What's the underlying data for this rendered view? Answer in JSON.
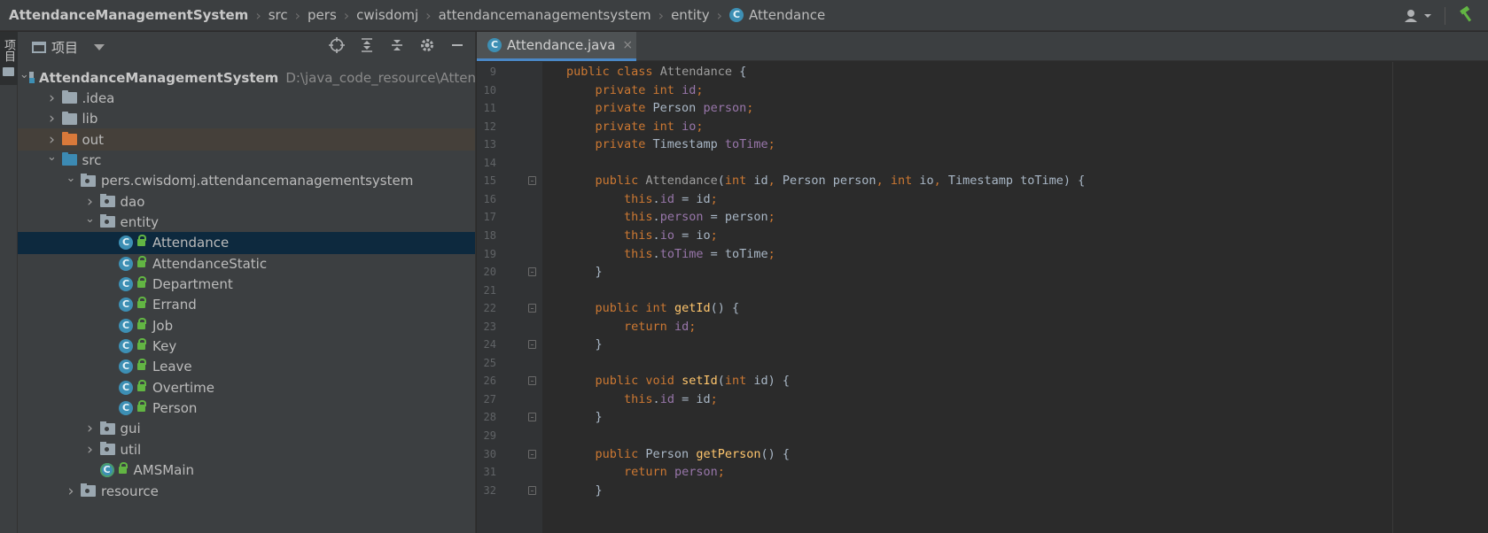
{
  "navbar": {
    "breadcrumbs": [
      "AttendanceManagementSystem",
      "src",
      "pers",
      "cwisdomj",
      "attendancemanagementsystem",
      "entity",
      "Attendance"
    ],
    "class_icon_letter": "C"
  },
  "stripe": {
    "label": "项目"
  },
  "project_panel": {
    "title": "项目",
    "tree": [
      {
        "label": "AttendanceManagementSystem",
        "path": "D:\\java_code_resource\\Atten",
        "indent": 0,
        "expanded": true,
        "icon": "module-icon",
        "bold": true
      },
      {
        "label": ".idea",
        "indent": 1,
        "expanded": false,
        "icon": "folder-grey"
      },
      {
        "label": "lib",
        "indent": 1,
        "expanded": false,
        "icon": "folder-grey"
      },
      {
        "label": "out",
        "indent": 1,
        "expanded": false,
        "icon": "folder-orange",
        "highlight": "out"
      },
      {
        "label": "src",
        "indent": 1,
        "expanded": true,
        "icon": "folder-blue"
      },
      {
        "label": "pers.cwisdomj.attendancemanagementsystem",
        "indent": 2,
        "expanded": true,
        "icon": "package"
      },
      {
        "label": "dao",
        "indent": 3,
        "expanded": false,
        "icon": "package"
      },
      {
        "label": "entity",
        "indent": 3,
        "expanded": true,
        "icon": "package"
      },
      {
        "label": "Attendance",
        "indent": 4,
        "icon": "class",
        "selected": true
      },
      {
        "label": "AttendanceStatic",
        "indent": 4,
        "icon": "class"
      },
      {
        "label": "Department",
        "indent": 4,
        "icon": "class"
      },
      {
        "label": "Errand",
        "indent": 4,
        "icon": "class"
      },
      {
        "label": "Job",
        "indent": 4,
        "icon": "class"
      },
      {
        "label": "Key",
        "indent": 4,
        "icon": "class"
      },
      {
        "label": "Leave",
        "indent": 4,
        "icon": "class"
      },
      {
        "label": "Overtime",
        "indent": 4,
        "icon": "class"
      },
      {
        "label": "Person",
        "indent": 4,
        "icon": "class"
      },
      {
        "label": "gui",
        "indent": 3,
        "expanded": false,
        "icon": "package"
      },
      {
        "label": "util",
        "indent": 3,
        "expanded": false,
        "icon": "package"
      },
      {
        "label": "AMSMain",
        "indent": 3,
        "icon": "class-run"
      },
      {
        "label": "resource",
        "indent": 2,
        "expanded": false,
        "icon": "package"
      }
    ]
  },
  "editor": {
    "tab_label": "Attendance.java",
    "lines": [
      {
        "n": "9",
        "tokens": [
          [
            "kw",
            "public "
          ],
          [
            "kw",
            "class "
          ],
          [
            "gray-cls",
            "Attendance "
          ],
          [
            "cn",
            "{"
          ]
        ]
      },
      {
        "n": "10",
        "tokens": [
          [
            "cn",
            "    "
          ],
          [
            "kw",
            "private "
          ],
          [
            "kw",
            "int "
          ],
          [
            "fld",
            "id"
          ],
          [
            "pun",
            ";"
          ]
        ]
      },
      {
        "n": "11",
        "tokens": [
          [
            "cn",
            "    "
          ],
          [
            "kw",
            "private "
          ],
          [
            "cn",
            "Person "
          ],
          [
            "fld",
            "person"
          ],
          [
            "pun",
            ";"
          ]
        ]
      },
      {
        "n": "12",
        "tokens": [
          [
            "cn",
            "    "
          ],
          [
            "kw",
            "private "
          ],
          [
            "kw",
            "int "
          ],
          [
            "fld",
            "io"
          ],
          [
            "pun",
            ";"
          ]
        ]
      },
      {
        "n": "13",
        "tokens": [
          [
            "cn",
            "    "
          ],
          [
            "kw",
            "private "
          ],
          [
            "cn",
            "Timestamp "
          ],
          [
            "fld",
            "toTime"
          ],
          [
            "pun",
            ";"
          ]
        ]
      },
      {
        "n": "14",
        "tokens": []
      },
      {
        "n": "15",
        "fold": true,
        "tokens": [
          [
            "cn",
            "    "
          ],
          [
            "kw",
            "public "
          ],
          [
            "gray-cls",
            "Attendance"
          ],
          [
            "cn",
            "("
          ],
          [
            "kw",
            "int "
          ],
          [
            "cn",
            "id"
          ],
          [
            "pun",
            ", "
          ],
          [
            "cn",
            "Person person"
          ],
          [
            "pun",
            ", "
          ],
          [
            "kw",
            "int "
          ],
          [
            "cn",
            "io"
          ],
          [
            "pun",
            ", "
          ],
          [
            "cn",
            "Timestamp toTime) {"
          ]
        ]
      },
      {
        "n": "16",
        "tokens": [
          [
            "cn",
            "        "
          ],
          [
            "kw",
            "this"
          ],
          [
            "cn",
            "."
          ],
          [
            "fld",
            "id"
          ],
          [
            "cn",
            " = id"
          ],
          [
            "pun",
            ";"
          ]
        ]
      },
      {
        "n": "17",
        "tokens": [
          [
            "cn",
            "        "
          ],
          [
            "kw",
            "this"
          ],
          [
            "cn",
            "."
          ],
          [
            "fld",
            "person"
          ],
          [
            "cn",
            " = person"
          ],
          [
            "pun",
            ";"
          ]
        ]
      },
      {
        "n": "18",
        "tokens": [
          [
            "cn",
            "        "
          ],
          [
            "kw",
            "this"
          ],
          [
            "cn",
            "."
          ],
          [
            "fld",
            "io"
          ],
          [
            "cn",
            " = io"
          ],
          [
            "pun",
            ";"
          ]
        ]
      },
      {
        "n": "19",
        "tokens": [
          [
            "cn",
            "        "
          ],
          [
            "kw",
            "this"
          ],
          [
            "cn",
            "."
          ],
          [
            "fld",
            "toTime"
          ],
          [
            "cn",
            " = toTime"
          ],
          [
            "pun",
            ";"
          ]
        ]
      },
      {
        "n": "20",
        "fold": true,
        "tokens": [
          [
            "cn",
            "    }"
          ]
        ]
      },
      {
        "n": "21",
        "tokens": []
      },
      {
        "n": "22",
        "fold": true,
        "tokens": [
          [
            "cn",
            "    "
          ],
          [
            "kw",
            "public "
          ],
          [
            "kw",
            "int "
          ],
          [
            "mth",
            "getId"
          ],
          [
            "cn",
            "() {"
          ]
        ]
      },
      {
        "n": "23",
        "tokens": [
          [
            "cn",
            "        "
          ],
          [
            "kw",
            "return "
          ],
          [
            "fld",
            "id"
          ],
          [
            "pun",
            ";"
          ]
        ]
      },
      {
        "n": "24",
        "fold": true,
        "tokens": [
          [
            "cn",
            "    }"
          ]
        ]
      },
      {
        "n": "25",
        "tokens": []
      },
      {
        "n": "26",
        "fold": true,
        "tokens": [
          [
            "cn",
            "    "
          ],
          [
            "kw",
            "public "
          ],
          [
            "kw",
            "void "
          ],
          [
            "mth",
            "setId"
          ],
          [
            "cn",
            "("
          ],
          [
            "kw",
            "int "
          ],
          [
            "cn",
            "id) {"
          ]
        ]
      },
      {
        "n": "27",
        "tokens": [
          [
            "cn",
            "        "
          ],
          [
            "kw",
            "this"
          ],
          [
            "cn",
            "."
          ],
          [
            "fld",
            "id"
          ],
          [
            "cn",
            " = id"
          ],
          [
            "pun",
            ";"
          ]
        ]
      },
      {
        "n": "28",
        "fold": true,
        "tokens": [
          [
            "cn",
            "    }"
          ]
        ]
      },
      {
        "n": "29",
        "tokens": []
      },
      {
        "n": "30",
        "fold": true,
        "tokens": [
          [
            "cn",
            "    "
          ],
          [
            "kw",
            "public "
          ],
          [
            "cn",
            "Person "
          ],
          [
            "mth",
            "getPerson"
          ],
          [
            "cn",
            "() {"
          ]
        ]
      },
      {
        "n": "31",
        "tokens": [
          [
            "cn",
            "        "
          ],
          [
            "kw",
            "return "
          ],
          [
            "fld",
            "person"
          ],
          [
            "pun",
            ";"
          ]
        ]
      },
      {
        "n": "32",
        "fold": true,
        "tokens": [
          [
            "cn",
            "    }"
          ]
        ]
      }
    ]
  }
}
